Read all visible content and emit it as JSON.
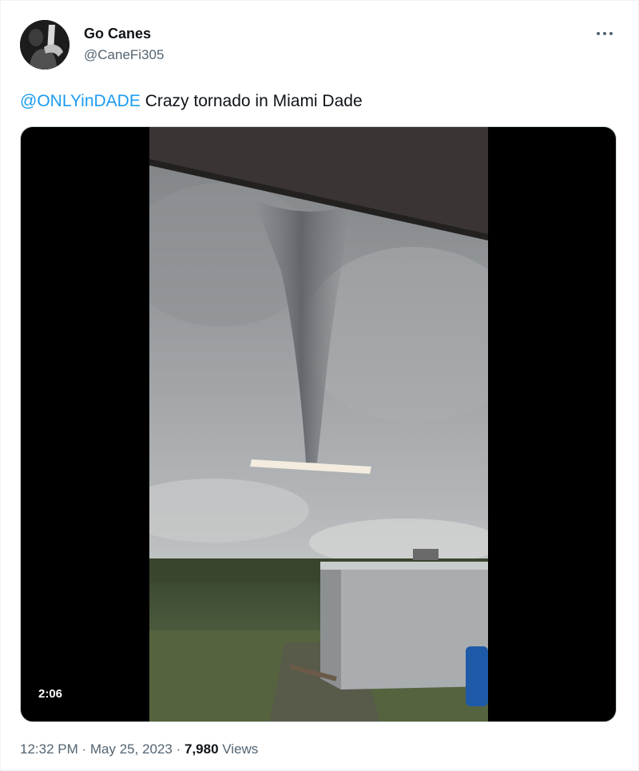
{
  "author": {
    "display_name": "Go Canes",
    "handle": "@CaneFi305"
  },
  "tweet": {
    "mention": "@ONLYinDADE",
    "text": " Crazy tornado in Miami Dade"
  },
  "media": {
    "type": "video",
    "duration": "2:06"
  },
  "meta": {
    "time": "12:32 PM",
    "separator": " · ",
    "date": "May 25, 2023",
    "views_count": "7,980",
    "views_label": " Views"
  },
  "icons": {
    "more": "more-horizontal-icon"
  },
  "colors": {
    "link": "#1d9bf0",
    "secondary_text": "#536471",
    "primary_text": "#0f1419"
  }
}
